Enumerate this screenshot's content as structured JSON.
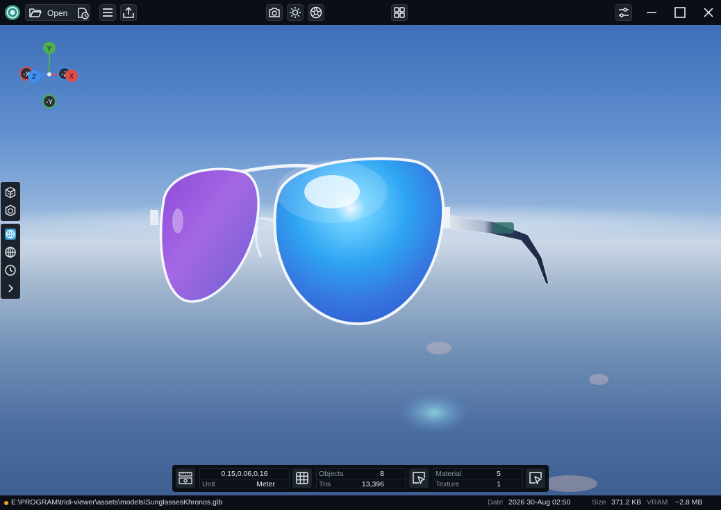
{
  "toolbar": {
    "open_label": "Open",
    "icons": [
      "app-logo-icon",
      "folder-open-icon",
      "recent-files-icon",
      "menu-icon",
      "export-icon",
      "camera-icon",
      "sun-icon",
      "aperture-icon",
      "layout-grid-icon",
      "settings-sliders-icon",
      "minimize-icon",
      "maximize-icon",
      "close-icon"
    ]
  },
  "gizmo": {
    "y": "Y",
    "neg_y": "-Y",
    "x": "X",
    "neg_x": "-X",
    "z": "Z",
    "neg_z": "-Z",
    "colors": {
      "x": "#e34b4b",
      "y": "#4caf50",
      "z": "#3f8ff0"
    }
  },
  "sidebar": {
    "items": [
      "cube-filled-icon",
      "cube-outline-icon",
      "environment-icon",
      "grid-globe-icon",
      "clock-icon",
      "chevron-right-icon"
    ],
    "active": "environment-icon"
  },
  "stats": {
    "dimensions": "0.15,0.06,0.16",
    "unit_label": "Unit",
    "unit_value": "Meter",
    "objects_label": "Objects",
    "objects_value": "8",
    "tris_label": "Tris",
    "tris_value": "13,396",
    "material_label": "Material",
    "material_value": "5",
    "texture_label": "Texture",
    "texture_value": "1"
  },
  "status": {
    "path": "E:\\PROGRAM\\tridi-viewer\\assets\\models\\SunglassesKhronos.glb",
    "date_label": "Date",
    "date_value": "2026 30-Aug 02:50",
    "size_label": "Size",
    "size_value": "371.2 KB",
    "vram_label": "VRAM",
    "vram_value": "~2.8 MB",
    "indicator_color": "#e8a317"
  },
  "accent": "#3aa0d8"
}
